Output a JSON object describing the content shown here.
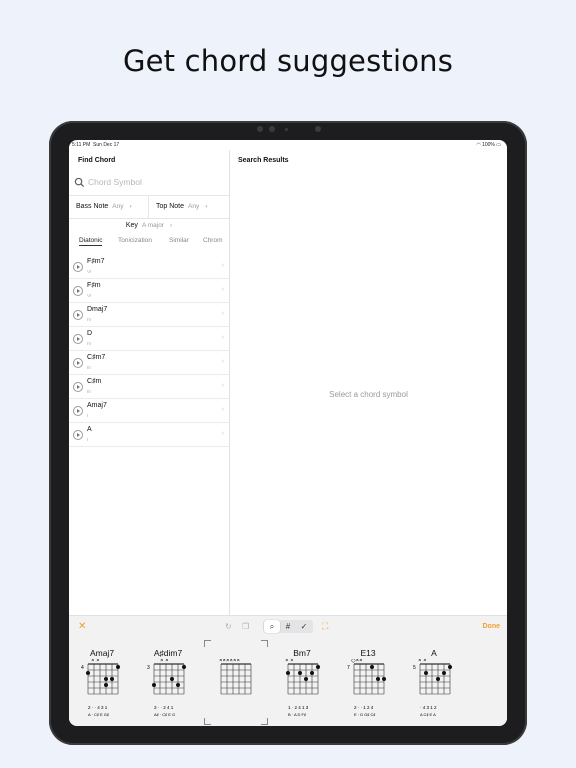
{
  "headline": "Get chord suggestions",
  "status": {
    "time": "5:11 PM",
    "date": "Sun Dec 17",
    "battery": "100%"
  },
  "sidebar": {
    "title": "Find Chord",
    "search_placeholder": "Chord Symbol",
    "bass_note_label": "Bass Note",
    "bass_note_value": "Any",
    "top_note_label": "Top Note",
    "top_note_value": "Any",
    "key_label": "Key",
    "key_value": "A major",
    "tabs": [
      "Diatonic",
      "Tonicization",
      "Similar",
      "Chrom"
    ],
    "chords": [
      {
        "name": "F♯m7",
        "degree": "VI"
      },
      {
        "name": "F♯m",
        "degree": "VI"
      },
      {
        "name": "Dmaj7",
        "degree": "IV"
      },
      {
        "name": "D",
        "degree": "IV"
      },
      {
        "name": "C♯m7",
        "degree": "III"
      },
      {
        "name": "C♯m",
        "degree": "III"
      },
      {
        "name": "Amaj7",
        "degree": "I"
      },
      {
        "name": "A",
        "degree": "I"
      }
    ]
  },
  "results": {
    "title": "Search Results",
    "empty_text": "Select a chord symbol"
  },
  "tray": {
    "done_label": "Done",
    "chords": [
      {
        "name": "Amaj7",
        "fret": "4",
        "fingers": "2 · · 4 3 1",
        "notes": "A · C♯ E G♯"
      },
      {
        "name": "A♯dim7",
        "fret": "3",
        "fingers": "3 · · 2 4 1",
        "notes": "A♯ · C♯ E G"
      },
      {
        "name": "",
        "fret": "",
        "fingers": "",
        "notes": ""
      },
      {
        "name": "Bm7",
        "fret": "",
        "fingers": "1 · 2 4 1 3",
        "notes": "B · A D F♯"
      },
      {
        "name": "E13",
        "fret": "7",
        "fingers": "2 · · 1 2 4",
        "notes": "E · D G♯ C♯"
      },
      {
        "name": "A",
        "fret": "5",
        "fingers": "· 4 3 1 2",
        "notes": "A C♯ E A"
      }
    ]
  },
  "colors": {
    "accent": "#f0a030",
    "background": "#eef2fb"
  }
}
